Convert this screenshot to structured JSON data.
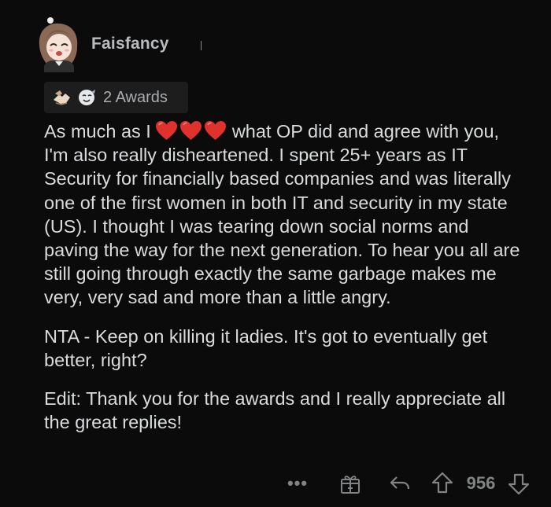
{
  "comment": {
    "username": "Faisfancy",
    "awards_label": "2 Awards",
    "body_line1_before": "As much as I",
    "body_line1_after": "what OP did and agree with you, I'm also really disheartened. I spent 25+ years as IT Security for financially based companies and was literally one of the first women in both IT and security in my state (US). I thought I was tearing down social norms and paving the way for the next generation. To hear you all are still going through exactly the same garbage makes me very, very sad and more than a little angry.",
    "paragraph2": "NTA - Keep on killing it ladies. It's got to eventually get better, right?",
    "paragraph3": "Edit: Thank you for the awards and I really appreciate all the great replies!",
    "heart_emoji_count": 3,
    "score": "956",
    "more_label": "•••"
  },
  "icons": {
    "avatar": "anime-avatar-icon",
    "award1": "helping-hand-award-icon",
    "award2": "wholesome-award-icon",
    "heart": "red-heart-emoji-icon",
    "gift": "give-award-icon",
    "reply": "reply-icon",
    "upvote": "upvote-arrow-icon",
    "downvote": "downvote-arrow-icon"
  },
  "colors": {
    "background": "#0b0b0b",
    "text": "#d9dbdd",
    "muted": "#818384",
    "heart": "#e0312c"
  }
}
